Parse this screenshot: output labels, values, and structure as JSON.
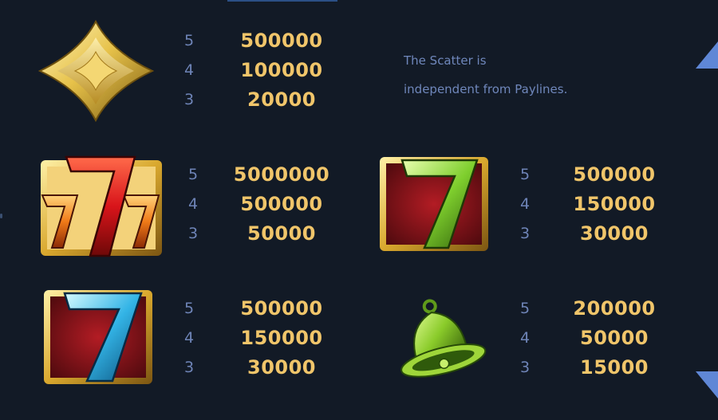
{
  "paytable": {
    "entries": [
      {
        "symbol": "gold-diamond-icon",
        "rows": [
          {
            "count": "5",
            "payout": "500000"
          },
          {
            "count": "4",
            "payout": "100000"
          },
          {
            "count": "3",
            "payout": "20000"
          }
        ]
      },
      {
        "symbol": "triple-seven-icon",
        "rows": [
          {
            "count": "5",
            "payout": "5000000"
          },
          {
            "count": "4",
            "payout": "500000"
          },
          {
            "count": "3",
            "payout": "50000"
          }
        ]
      },
      {
        "symbol": "green-seven-icon",
        "rows": [
          {
            "count": "5",
            "payout": "500000"
          },
          {
            "count": "4",
            "payout": "150000"
          },
          {
            "count": "3",
            "payout": "30000"
          }
        ]
      },
      {
        "symbol": "blue-seven-icon",
        "rows": [
          {
            "count": "5",
            "payout": "500000"
          },
          {
            "count": "4",
            "payout": "150000"
          },
          {
            "count": "3",
            "payout": "30000"
          }
        ]
      },
      {
        "symbol": "green-bell-icon",
        "rows": [
          {
            "count": "5",
            "payout": "200000"
          },
          {
            "count": "4",
            "payout": "50000"
          },
          {
            "count": "3",
            "payout": "15000"
          }
        ]
      }
    ]
  },
  "scatter_note": {
    "line1": "The Scatter is",
    "line2": "independent from Paylines."
  },
  "nav": {
    "up_icon": "triangle-up-icon",
    "down_icon": "triangle-down-icon"
  },
  "colors": {
    "background": "#121a26",
    "payout": "#f0c56a",
    "count": "#6e84b7",
    "note": "#6f87bb",
    "arrow": "#5f87d6"
  }
}
